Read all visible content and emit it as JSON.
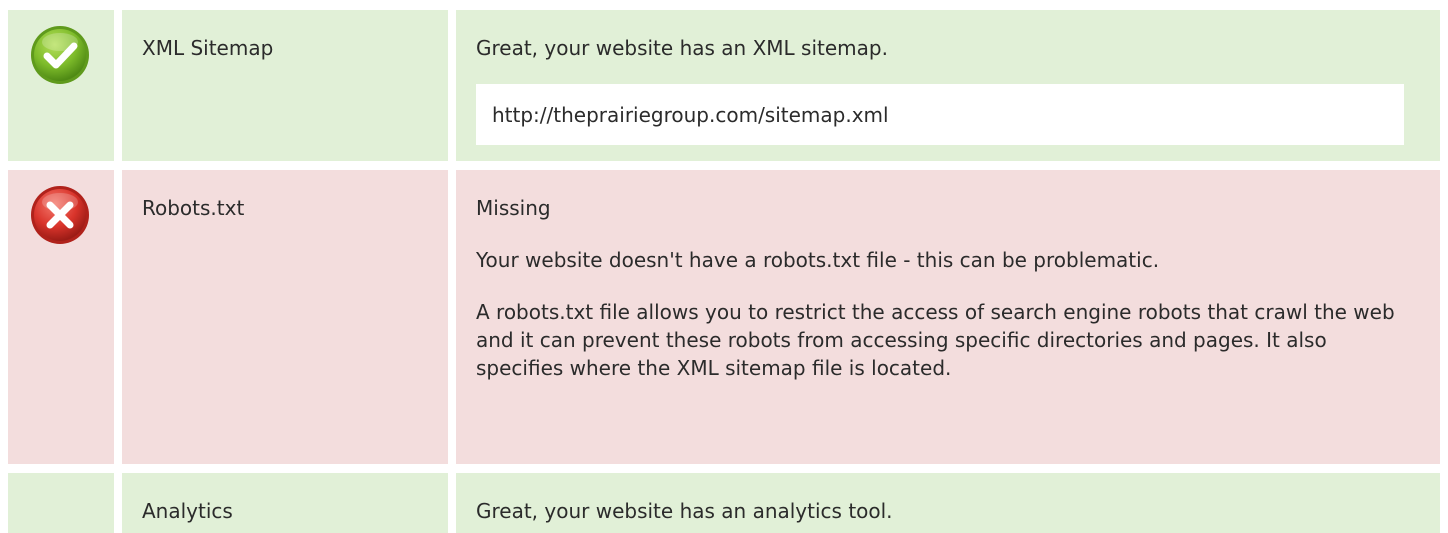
{
  "colors": {
    "pass_bg": "#e1f0d7",
    "fail_bg": "#f3dddd",
    "pass_icon": "#7dbb2a",
    "fail_icon": "#d9342b"
  },
  "rows": {
    "sitemap": {
      "status": "pass",
      "icon": "check-circle-icon",
      "title": "XML Sitemap",
      "message": "Great, your website has an XML sitemap.",
      "url": "http://theprairiegroup.com/sitemap.xml"
    },
    "robots": {
      "status": "fail",
      "icon": "cross-circle-icon",
      "title": "Robots.txt",
      "status_text": "Missing",
      "message": "Your website doesn't have a robots.txt file - this can be problematic.",
      "description": "A robots.txt file allows you to restrict the access of search engine robots that crawl the web and it can prevent these robots from accessing specific directories and pages. It also specifies where the XML sitemap file is located."
    },
    "analytics": {
      "status": "pass",
      "title": "Analytics",
      "message": "Great, your website has an analytics tool."
    }
  }
}
